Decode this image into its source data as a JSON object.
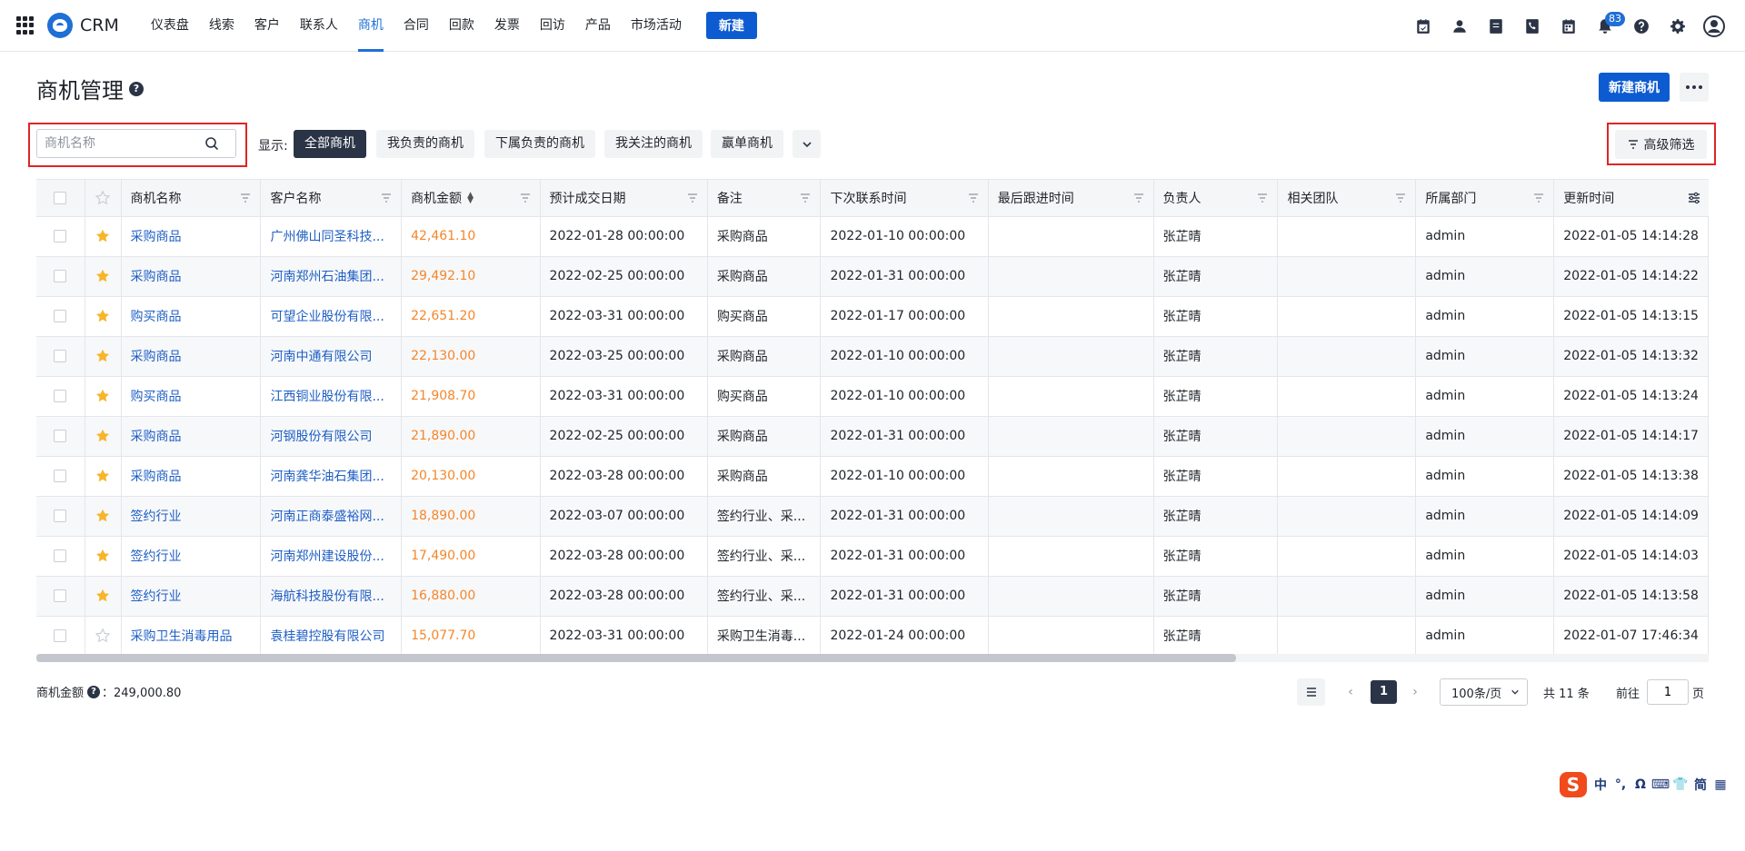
{
  "app": {
    "name": "CRM"
  },
  "nav": {
    "items": [
      {
        "label": "仪表盘",
        "active": false
      },
      {
        "label": "线索",
        "active": false
      },
      {
        "label": "客户",
        "active": false
      },
      {
        "label": "联系人",
        "active": false
      },
      {
        "label": "商机",
        "active": true
      },
      {
        "label": "合同",
        "active": false
      },
      {
        "label": "回款",
        "active": false
      },
      {
        "label": "发票",
        "active": false
      },
      {
        "label": "回访",
        "active": false
      },
      {
        "label": "产品",
        "active": false
      },
      {
        "label": "市场活动",
        "active": false
      }
    ],
    "new_label": "新建",
    "notification_count": "83",
    "icons": [
      "task-icon",
      "contact-card-icon",
      "note-icon",
      "phone-icon",
      "calendar-icon",
      "bell-icon",
      "help-icon",
      "gear-icon",
      "avatar-icon"
    ]
  },
  "page": {
    "title": "商机管理",
    "create_label": "新建商机"
  },
  "filters": {
    "search_placeholder": "商机名称",
    "show_label": "显示:",
    "segments": [
      "全部商机",
      "我负责的商机",
      "下属负责的商机",
      "我关注的商机",
      "赢单商机"
    ],
    "active_segment": 0,
    "advanced_label": "高级筛选"
  },
  "table": {
    "columns": [
      "商机名称",
      "客户名称",
      "商机金额",
      "预计成交日期",
      "备注",
      "下次联系时间",
      "最后跟进时间",
      "负责人",
      "相关团队",
      "所属部门",
      "更新时间"
    ],
    "rows": [
      {
        "starred": true,
        "name": "采购商品",
        "customer": "广州佛山同圣科技...",
        "amount": "42,461.10",
        "deal_date": "2022-01-28 00:00:00",
        "remark": "采购商品",
        "next_contact": "2022-01-10 00:00:00",
        "last_follow": "",
        "owner": "张芷晴",
        "team": "",
        "dept": "admin",
        "updated": "2022-01-05 14:14:28"
      },
      {
        "starred": true,
        "name": "采购商品",
        "customer": "河南郑州石油集团...",
        "amount": "29,492.10",
        "deal_date": "2022-02-25 00:00:00",
        "remark": "采购商品",
        "next_contact": "2022-01-31 00:00:00",
        "last_follow": "",
        "owner": "张芷晴",
        "team": "",
        "dept": "admin",
        "updated": "2022-01-05 14:14:22"
      },
      {
        "starred": true,
        "name": "购买商品",
        "customer": "可望企业股份有限...",
        "amount": "22,651.20",
        "deal_date": "2022-03-31 00:00:00",
        "remark": "购买商品",
        "next_contact": "2022-01-17 00:00:00",
        "last_follow": "",
        "owner": "张芷晴",
        "team": "",
        "dept": "admin",
        "updated": "2022-01-05 14:13:15"
      },
      {
        "starred": true,
        "name": "采购商品",
        "customer": "河南中通有限公司",
        "amount": "22,130.00",
        "deal_date": "2022-03-25 00:00:00",
        "remark": "采购商品",
        "next_contact": "2022-01-10 00:00:00",
        "last_follow": "",
        "owner": "张芷晴",
        "team": "",
        "dept": "admin",
        "updated": "2022-01-05 14:13:32"
      },
      {
        "starred": true,
        "name": "购买商品",
        "customer": "江西铜业股份有限...",
        "amount": "21,908.70",
        "deal_date": "2022-03-31 00:00:00",
        "remark": "购买商品",
        "next_contact": "2022-01-10 00:00:00",
        "last_follow": "",
        "owner": "张芷晴",
        "team": "",
        "dept": "admin",
        "updated": "2022-01-05 14:13:24"
      },
      {
        "starred": true,
        "name": "采购商品",
        "customer": "河钢股份有限公司",
        "amount": "21,890.00",
        "deal_date": "2022-02-25 00:00:00",
        "remark": "采购商品",
        "next_contact": "2022-01-31 00:00:00",
        "last_follow": "",
        "owner": "张芷晴",
        "team": "",
        "dept": "admin",
        "updated": "2022-01-05 14:14:17"
      },
      {
        "starred": true,
        "name": "采购商品",
        "customer": "河南龚华油石集团...",
        "amount": "20,130.00",
        "deal_date": "2022-03-28 00:00:00",
        "remark": "采购商品",
        "next_contact": "2022-01-10 00:00:00",
        "last_follow": "",
        "owner": "张芷晴",
        "team": "",
        "dept": "admin",
        "updated": "2022-01-05 14:13:38"
      },
      {
        "starred": true,
        "name": "签约行业",
        "customer": "河南正商泰盛裕网...",
        "amount": "18,890.00",
        "deal_date": "2022-03-07 00:00:00",
        "remark": "签约行业、采...",
        "next_contact": "2022-01-31 00:00:00",
        "last_follow": "",
        "owner": "张芷晴",
        "team": "",
        "dept": "admin",
        "updated": "2022-01-05 14:14:09"
      },
      {
        "starred": true,
        "name": "签约行业",
        "customer": "河南郑州建设股份...",
        "amount": "17,490.00",
        "deal_date": "2022-03-28 00:00:00",
        "remark": "签约行业、采...",
        "next_contact": "2022-01-31 00:00:00",
        "last_follow": "",
        "owner": "张芷晴",
        "team": "",
        "dept": "admin",
        "updated": "2022-01-05 14:14:03"
      },
      {
        "starred": true,
        "name": "签约行业",
        "customer": "海航科技股份有限...",
        "amount": "16,880.00",
        "deal_date": "2022-03-28 00:00:00",
        "remark": "签约行业、采...",
        "next_contact": "2022-01-31 00:00:00",
        "last_follow": "",
        "owner": "张芷晴",
        "team": "",
        "dept": "admin",
        "updated": "2022-01-05 14:13:58"
      },
      {
        "starred": false,
        "name": "采购卫生消毒用品",
        "customer": "袁桂碧控股有限公司",
        "amount": "15,077.70",
        "deal_date": "2022-03-31 00:00:00",
        "remark": "采购卫生消毒...",
        "next_contact": "2022-01-24 00:00:00",
        "last_follow": "",
        "owner": "张芷晴",
        "team": "",
        "dept": "admin",
        "updated": "2022-01-07 17:46:34"
      }
    ]
  },
  "footer": {
    "sum_label": "商机金额",
    "sum_value": "：249,000.80",
    "current_page": "1",
    "page_size": "100条/页",
    "total": "共 11 条",
    "goto_label": "前往",
    "goto_value": "1",
    "goto_unit": "页"
  },
  "ime": {
    "items": [
      "中",
      "°,",
      "Ω",
      "⌨",
      "👕",
      "简",
      "▦"
    ]
  },
  "colors": {
    "primary": "#0d5bd1",
    "link": "#1f5fc4",
    "amount": "#f5862a",
    "highlight": "#e02424",
    "star": "#f7b52a"
  }
}
